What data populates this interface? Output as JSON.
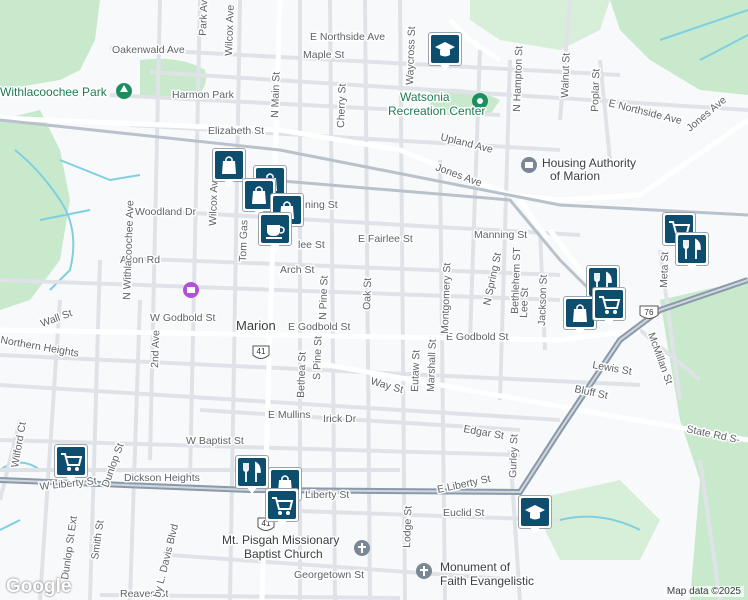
{
  "map": {
    "attribution": "Google",
    "copyright": "Map data ©2025",
    "colors": {
      "park": "#c5e8c9",
      "water": "#7fcfe0",
      "road": "#ffffff",
      "highway": "#8a9aaa",
      "marker": "#0d4d6e",
      "poi_green": "#1e8e5e"
    }
  },
  "labels": {
    "town": "Marion",
    "withlacoochee_park": "Withlacoochee Park",
    "watsonia": "Watsonia",
    "recreation_center": "Recreation Center",
    "housing_authority_1": "Housing Authority",
    "housing_authority_2": "of Marion",
    "mt_pisgah_1": "Mt. Pisgah Missionary",
    "mt_pisgah_2": "Baptist Church",
    "monument_1": "Monument of",
    "monument_2": "Faith Evangelistic",
    "e_godbold": "E Godbold St",
    "e_godbold_2": "E Godbold St",
    "w_godbold": "W Godbold St",
    "e_liberty": "E Liberty St",
    "w_liberty": "W Liberty St",
    "liberty_mid": "Liberty St",
    "jones_ave": "Jones Ave",
    "jones_ave_ne": "Jones Ave",
    "bluff_st": "Bluff St",
    "state_rd": "State Rd S-",
    "elizabeth_st": "Elizabeth St",
    "harmon_park": "Harmon Park",
    "oakenwald_ave": "Oakenwald Ave",
    "maple_st": "Maple St",
    "e_northside": "E Northside Ave",
    "e_northside_east": "E Northside Ave",
    "upland_ave": "Upland Ave",
    "woodland_dr": "Woodland Dr",
    "avon_rd": "Avon Rd",
    "arch_st": "Arch St",
    "e_fairlee": "E Fairlee St",
    "fairlee_w": "lee St",
    "manning_st": "Manning St",
    "manning_w": "ning St",
    "lewis_st": "Lewis St",
    "edgar_st": "Edgar St",
    "euclid_st": "Euclid St",
    "georgetown_st": "Georgetown St",
    "reaves_st": "Reaves St",
    "dickson_heights": "Dickson Heights",
    "w_baptist": "W Baptist St",
    "e_mullins": "E Mullins",
    "irick_dr": "Irick Dr",
    "way_st": "Way St",
    "wall_st": "Wall St",
    "northern_heights": "Northern Heights",
    "n_main_st": "N Main St",
    "n_pine_st": "N Pine St",
    "s_pine_st": "S Pine St",
    "bethea_st": "Bethea St",
    "oak_st": "Oak St",
    "cherry_st": "Cherry St",
    "waycross_st": "Waycross St",
    "n_hampton_st": "N Hampton St",
    "walnut_st": "Walnut St",
    "poplar_st": "Poplar St",
    "n_withlacoochee": "N Withlacoochee Ave",
    "wilcox_ave": "Wilcox Ave",
    "wilcox_ave_2": "Wilcox Ave",
    "park_ave": "Park Ave",
    "montgomery_st": "Montgomery St",
    "n_spring_st": "N Spring St",
    "bethlehem_st": "Bethlehem ST",
    "lee_st": "Lee St",
    "jackson_st": "Jackson St",
    "meta_st": "Meta St",
    "mcmillan_st": "McMillan St",
    "eutaw_st": "Eutaw St",
    "marshall_st": "Marshall St",
    "dunlop_st": "Dunlop St",
    "gurley_st": "Gurley St",
    "lodge_st": "Lodge St",
    "second_ave": "2nd Ave",
    "wilford_ct": "Wilford Ct",
    "dunlop_st_ext": "Dunlop St Ext",
    "smith_st": "Smith St",
    "davis_blvd": "by L. Davis Blvd",
    "tom_gasque": "Tom Gas",
    "hwy_41": "41",
    "hwy_41_b": "41",
    "hwy_76": "76"
  },
  "markers": [
    {
      "icon": "school-icon"
    },
    {
      "icon": "shopping-bag-icon"
    },
    {
      "icon": "shopping-bag-icon"
    },
    {
      "icon": "shopping-bag-icon"
    },
    {
      "icon": "shopping-bag-icon"
    },
    {
      "icon": "coffee-cup-icon"
    },
    {
      "icon": "shopping-cart-icon"
    },
    {
      "icon": "restaurant-icon"
    },
    {
      "icon": "restaurant-icon"
    },
    {
      "icon": "shopping-bag-icon"
    },
    {
      "icon": "shopping-cart-icon"
    },
    {
      "icon": "shopping-cart-icon"
    },
    {
      "icon": "restaurant-icon"
    },
    {
      "icon": "shopping-bag-icon"
    },
    {
      "icon": "shopping-cart-icon"
    },
    {
      "icon": "school-icon"
    }
  ]
}
